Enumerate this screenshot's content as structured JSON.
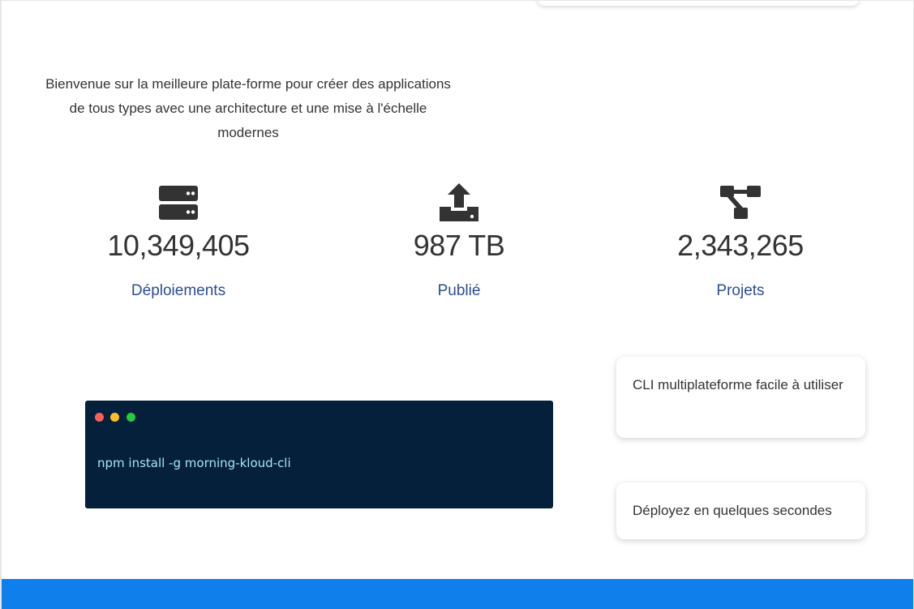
{
  "intro": {
    "text": "Bienvenue sur la meilleure plate-forme pour créer des applications de tous types avec une architecture et une mise à l'échelle modernes"
  },
  "stats": [
    {
      "icon": "server-icon",
      "value": "10,349,405",
      "label": "Déploiements"
    },
    {
      "icon": "upload-icon",
      "value": "987 TB",
      "label": "Publié"
    },
    {
      "icon": "project-diagram-icon",
      "value": "2,343,265",
      "label": "Projets"
    }
  ],
  "terminal": {
    "command": "npm install -g morning-kloud-cli",
    "dot_colors": [
      "#ff5f56",
      "#ffbd2e",
      "#27c93f"
    ]
  },
  "features": [
    {
      "text": "CLI multiplateforme facile à utiliser"
    },
    {
      "text": "Déployez en quelques secondes"
    }
  ],
  "colors": {
    "accent": "#0f7fec",
    "label_blue": "#2c4c94",
    "terminal_bg": "#04203b",
    "icon_dark": "#333333"
  }
}
